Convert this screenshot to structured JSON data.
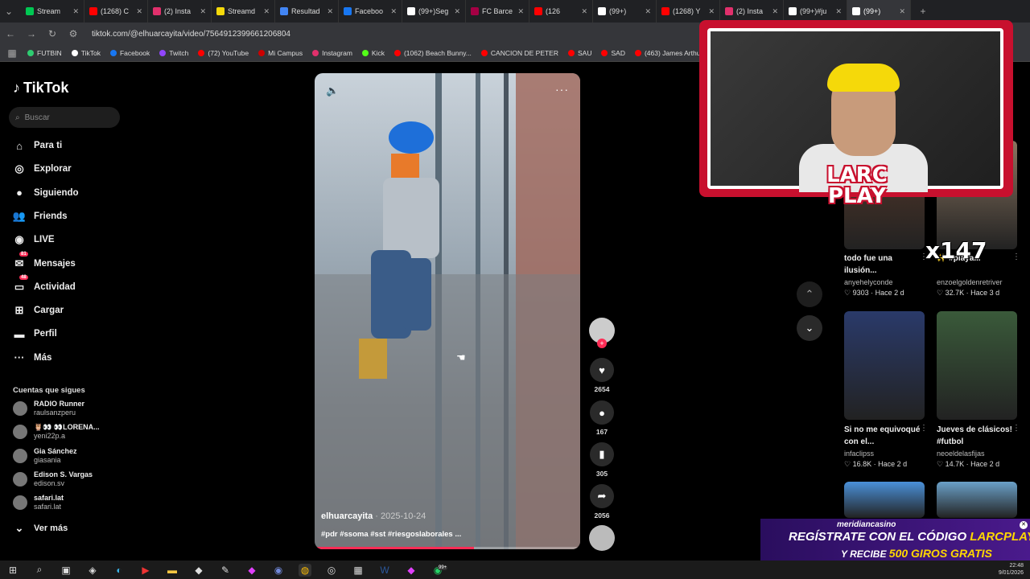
{
  "browser": {
    "tabs": [
      {
        "label": "Stream",
        "color": "#00c853"
      },
      {
        "label": "(1268) C",
        "color": "#ff0000"
      },
      {
        "label": "(2) Insta",
        "color": "#e1306c"
      },
      {
        "label": "Streamd",
        "color": "#f5d90a"
      },
      {
        "label": "Resultad",
        "color": "#4285f4"
      },
      {
        "label": "Faceboo",
        "color": "#1877f2"
      },
      {
        "label": "(99+)Seg",
        "color": "#ffffff"
      },
      {
        "label": "FC Barce",
        "color": "#a50044"
      },
      {
        "label": "(126",
        "color": "#ff0000"
      },
      {
        "label": "(99+)",
        "color": "#ffffff"
      },
      {
        "label": "(1268) Y",
        "color": "#ff0000"
      },
      {
        "label": "(2) Insta",
        "color": "#e1306c"
      },
      {
        "label": "(99+)#ju",
        "color": "#ffffff"
      },
      {
        "label": "(99+)",
        "color": "#ffffff"
      }
    ],
    "url": "tiktok.com/@elhuarcayita/video/7564912399661206804",
    "bookmarks": [
      {
        "label": "FUTBIN",
        "color": "#2ecc71"
      },
      {
        "label": "TikTok",
        "color": "#ffffff"
      },
      {
        "label": "Facebook",
        "color": "#1877f2"
      },
      {
        "label": "Twitch",
        "color": "#9146ff"
      },
      {
        "label": "(72) YouTube",
        "color": "#ff0000"
      },
      {
        "label": "Mi Campus",
        "color": "#cc0000"
      },
      {
        "label": "Instagram",
        "color": "#e1306c"
      },
      {
        "label": "Kick",
        "color": "#53fc18"
      },
      {
        "label": "(1062) Beach Bunny...",
        "color": "#ff0000"
      },
      {
        "label": "CANCION DE PETER",
        "color": "#ff0000"
      },
      {
        "label": "SAU",
        "color": "#ff0000"
      },
      {
        "label": "SAD",
        "color": "#ff0000"
      },
      {
        "label": "(463) James Arthur -...",
        "color": "#ff0000"
      }
    ]
  },
  "sidebar": {
    "logo": "TikTok",
    "search_placeholder": "Buscar",
    "items": [
      {
        "label": "Para ti",
        "icon": "⌂"
      },
      {
        "label": "Explorar",
        "icon": "◎"
      },
      {
        "label": "Siguiendo",
        "icon": "●"
      },
      {
        "label": "Friends",
        "icon": "👥"
      },
      {
        "label": "LIVE",
        "icon": "◉"
      },
      {
        "label": "Mensajes",
        "icon": "✉",
        "badge": "81"
      },
      {
        "label": "Actividad",
        "icon": "▭",
        "badge": "48"
      },
      {
        "label": "Cargar",
        "icon": "⊞"
      },
      {
        "label": "Perfil",
        "icon": "▬"
      },
      {
        "label": "Más",
        "icon": "···"
      }
    ],
    "following_title": "Cuentas que sigues",
    "accounts": [
      {
        "name": "RADIO Runner",
        "handle": "raulsanzperu"
      },
      {
        "name": "🦉👀 👀LORENA...",
        "handle": "yeni22p.a"
      },
      {
        "name": "Gia Sánchez",
        "handle": "giasania"
      },
      {
        "name": "Edison S. Vargas",
        "handle": "edison.sv"
      },
      {
        "name": "safari.lat",
        "handle": "safari.lat"
      }
    ],
    "see_more": "Ver más"
  },
  "video": {
    "author": "elhuarcayita",
    "date": "2025-10-24",
    "caption": "#pdr #ssoma #sst #riesgoslaborales ...",
    "progress": 0.6
  },
  "actions": {
    "likes": "2654",
    "comments": "167",
    "saves": "305",
    "shares": "2056"
  },
  "overlay": {
    "larc_line1": "LARC",
    "larc_line2": "PLAY",
    "x147": "x147"
  },
  "suggestions": [
    {
      "title": "todo fue una ilusión...",
      "user": "anyehelyconde",
      "likes": "9303",
      "age": "Hace 2 d",
      "color": "#5a3a2a"
    },
    {
      "title": "✨ #playa...",
      "user": "enzoelgoldenretriver",
      "likes": "32.7K",
      "age": "Hace 3 d",
      "color": "#8a7560"
    },
    {
      "title": "Si no me equivoqué con el...",
      "user": "infaclipss",
      "likes": "16.8K",
      "age": "Hace 2 d",
      "color": "#2a3a6a"
    },
    {
      "title": "Jueves de clásicos! #futbol",
      "user": "neoeldelasfijas",
      "likes": "14.7K",
      "age": "Hace 2 d",
      "color": "#3a5a3a"
    },
    {
      "title": "",
      "user": "",
      "likes": "",
      "age": "",
      "color": "#4a90d9"
    },
    {
      "title": "",
      "user": "",
      "likes": "",
      "age": "",
      "color": "#6aa0c8"
    }
  ],
  "ad": {
    "brand": "meridiancasino",
    "line1a": "REGÍSTRATE CON EL CÓDIGO ",
    "line1b": "LARCPLAY",
    "line2a": "Y RECIBE ",
    "line2b": "500 GIROS GRATIS"
  },
  "taskbar": {
    "time": "22:48",
    "date": "9/01/2026",
    "chat_badge": "99+"
  }
}
